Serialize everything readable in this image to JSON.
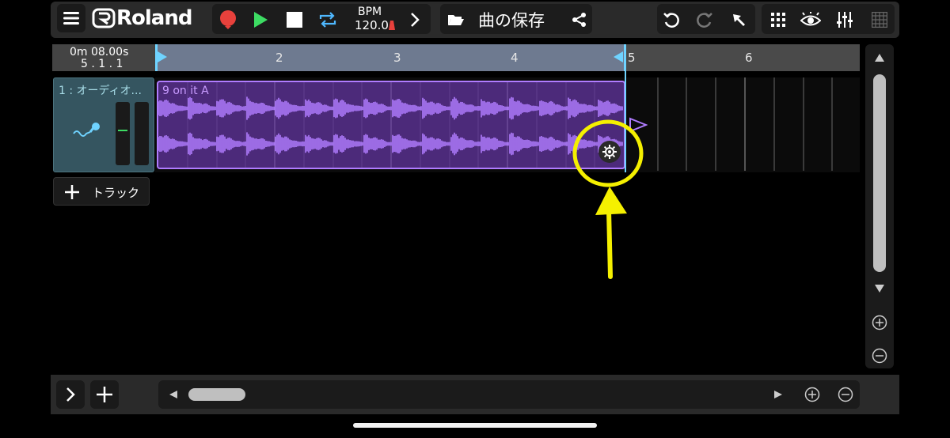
{
  "toolbar": {
    "brand": "Roland",
    "bpm_label": "BPM",
    "bpm_value": "120.0",
    "save_label": "曲の保存"
  },
  "position": {
    "time": "0m 08.00s",
    "bars": "5 . 1 . 1"
  },
  "ruler": {
    "marks": [
      "2",
      "3",
      "4",
      "5",
      "6"
    ]
  },
  "track": {
    "name": "1 : オーディオ...",
    "clip_name": "9 on it A"
  },
  "add_track_label": "トラック",
  "colors": {
    "background": "#000000",
    "panel": "#2b2b2b",
    "clip_fill": "#4c2a7a",
    "clip_border": "#b07cff",
    "waveform": "#b07cff",
    "loop_marker": "#6fd3ff",
    "record": "#e8413c",
    "play": "#3ddc63",
    "annotation": "#f5f000"
  }
}
